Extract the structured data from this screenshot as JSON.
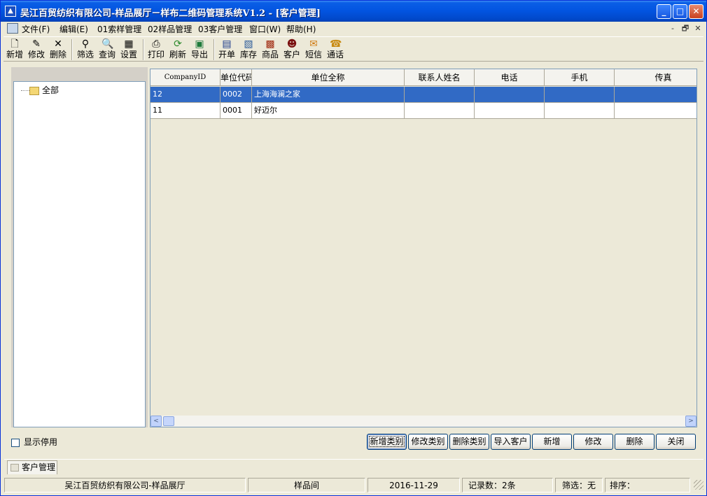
{
  "window": {
    "title": "吴江百贸纺织有限公司-样品展厅－样布二维码管理系统V1.2 - [客户管理]",
    "minimize_glyph": "_",
    "maximize_glyph": "□",
    "close_glyph": "✕"
  },
  "menu": {
    "items": [
      "文件(F)",
      "编辑(E)",
      "01索样管理",
      "02样品管理",
      "03客户管理",
      "窗口(W)",
      "帮助(H)"
    ],
    "mdi_controls": [
      "-",
      "🗗",
      "✕"
    ]
  },
  "toolbar": {
    "groups": [
      [
        {
          "label": "新增",
          "icon": "new-doc-icon",
          "glyph": "🗋"
        },
        {
          "label": "修改",
          "icon": "edit-brush-icon",
          "glyph": "✎"
        },
        {
          "label": "删除",
          "icon": "delete-x-icon",
          "glyph": "✕"
        }
      ],
      [
        {
          "label": "筛选",
          "icon": "binoculars-icon",
          "glyph": "⚲"
        },
        {
          "label": "查询",
          "icon": "magnifier-icon",
          "glyph": "🔍"
        },
        {
          "label": "设置",
          "icon": "grid-settings-icon",
          "glyph": "▦"
        }
      ],
      [
        {
          "label": "打印",
          "icon": "printer-icon",
          "glyph": "⎙"
        },
        {
          "label": "刷新",
          "icon": "refresh-icon",
          "glyph": "⟳"
        },
        {
          "label": "导出",
          "icon": "excel-export-icon",
          "glyph": "▣"
        }
      ],
      [
        {
          "label": "开单",
          "icon": "order-icon",
          "glyph": "▤"
        },
        {
          "label": "库存",
          "icon": "inventory-icon",
          "glyph": "▧"
        },
        {
          "label": "商品",
          "icon": "goods-icon",
          "glyph": "▩"
        },
        {
          "label": "客户",
          "icon": "customer-icon",
          "glyph": "☻"
        },
        {
          "label": "短信",
          "icon": "sms-icon",
          "glyph": "✉"
        },
        {
          "label": "通话",
          "icon": "phone-book-icon",
          "glyph": "☎"
        }
      ]
    ]
  },
  "tree": {
    "root_label": "全部"
  },
  "grid": {
    "columns": [
      "CompanyID",
      "单位代码",
      "单位全称",
      "联系人姓名",
      "电话",
      "手机",
      "传真"
    ],
    "rows": [
      {
        "cells": [
          "12",
          "0002",
          "上海海澜之家",
          "",
          "",
          "",
          ""
        ],
        "selected": true
      },
      {
        "cells": [
          "11",
          "0001",
          "好迈尔",
          "",
          "",
          "",
          ""
        ],
        "selected": false
      }
    ],
    "scroll_left_glyph": "<",
    "scroll_right_glyph": ">"
  },
  "footer": {
    "show_disabled_label": "显示停用",
    "buttons": [
      "新增类别",
      "修改类别",
      "删除类别",
      "导入客户",
      "新增",
      "修改",
      "删除",
      "关闭"
    ]
  },
  "mdi_tab": {
    "label": "客户管理"
  },
  "status": {
    "company": "吴江百贸纺织有限公司-样品展厅",
    "location": "样品间",
    "date": "2016-11-29",
    "record_count": "记录数：2条",
    "filter": "筛选：无",
    "sort": "排序："
  },
  "colors": {
    "title_blue": "#0254e0",
    "selection_blue": "#316ac5",
    "face": "#ece9d8"
  }
}
